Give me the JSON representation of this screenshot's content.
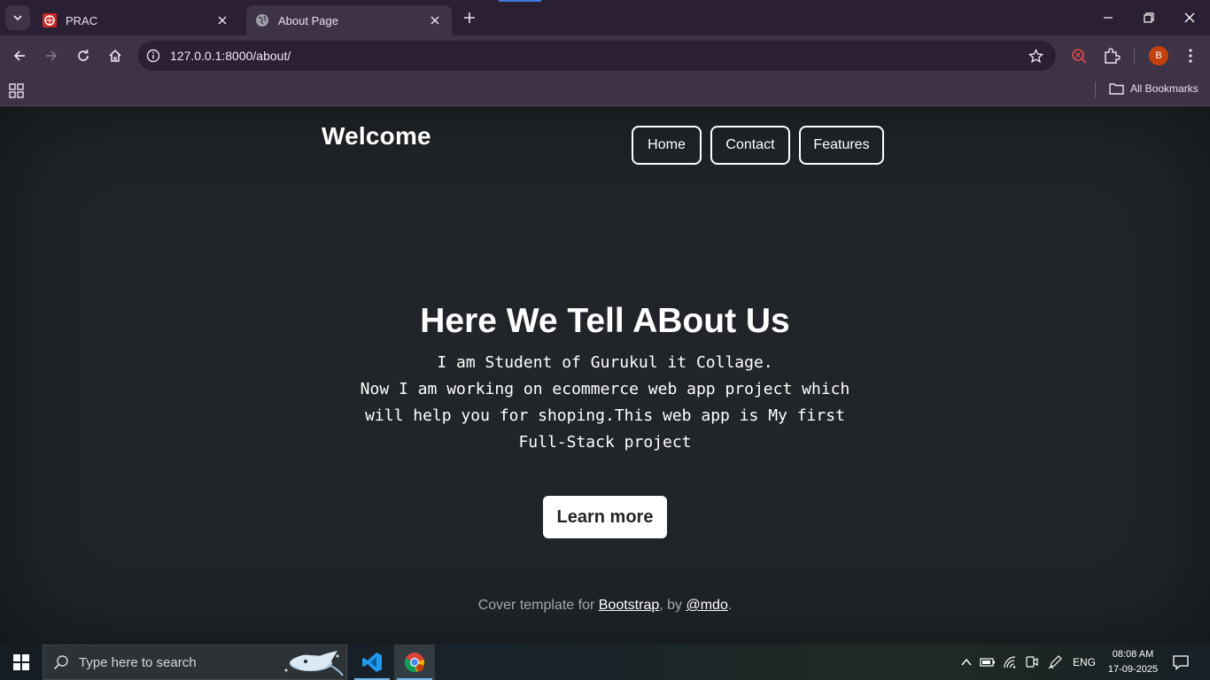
{
  "browser": {
    "tabs": [
      {
        "title": "PRAC",
        "icon": "prac-favicon",
        "active": false
      },
      {
        "title": "About Page",
        "icon": "globe-icon",
        "active": true
      }
    ],
    "url": "127.0.0.1:8000/about/",
    "profile_initial": "B",
    "bookmarks_label": "All Bookmarks"
  },
  "page": {
    "brand": "Welcome",
    "nav": [
      "Home",
      "Contact",
      "Features"
    ],
    "hero_title": "Here We Tell ABout Us",
    "hero_lines": [
      "I am Student of Gurukul it Collage.",
      "Now I am working on ecommerce web app project which",
      "will help you for shoping.This web app is My first",
      "Full-Stack project"
    ],
    "cta_label": "Learn more",
    "footer": {
      "prefix": "Cover template for ",
      "link1": "Bootstrap",
      "middle": ", by ",
      "link2": "@mdo",
      "suffix": "."
    }
  },
  "taskbar": {
    "search_placeholder": "Type here to search",
    "language": "ENG",
    "time": "08:08 AM",
    "date": "17-09-2025"
  },
  "colors": {
    "page_bg": "#212529",
    "chrome_dark": "#2a1f33",
    "chrome_light": "#3e3247",
    "profile": "#c2410c"
  }
}
